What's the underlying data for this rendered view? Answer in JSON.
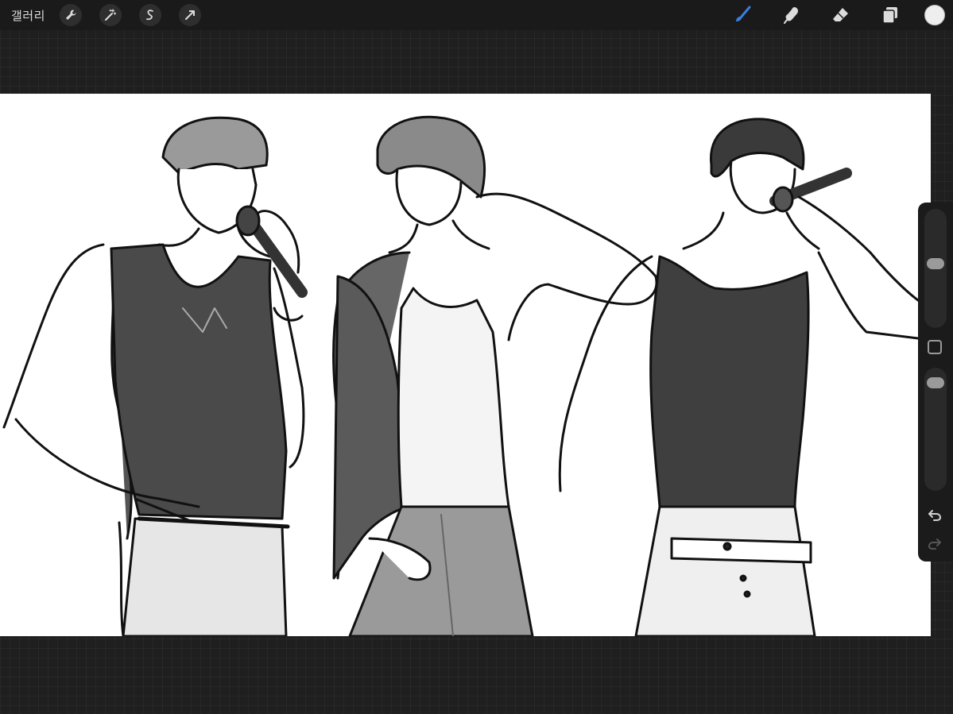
{
  "topbar": {
    "gallery_label": "갤러리",
    "left_tools": [
      "wrench-icon",
      "magic-wand-icon",
      "selection-icon",
      "transform-arrow-icon"
    ],
    "right_tools": [
      "brush-icon",
      "smudge-icon",
      "eraser-icon",
      "layers-icon"
    ],
    "active_tool": "brush-icon",
    "accent_color": "#3a7ee0",
    "current_color": "#eeeeee"
  },
  "sidebar": {
    "brush_size": 0.2,
    "opacity": 0.05,
    "icons": [
      "modify-square-icon",
      "undo-icon",
      "redo-icon"
    ]
  },
  "canvas": {
    "content": "artwork-three-figures-sketch"
  }
}
